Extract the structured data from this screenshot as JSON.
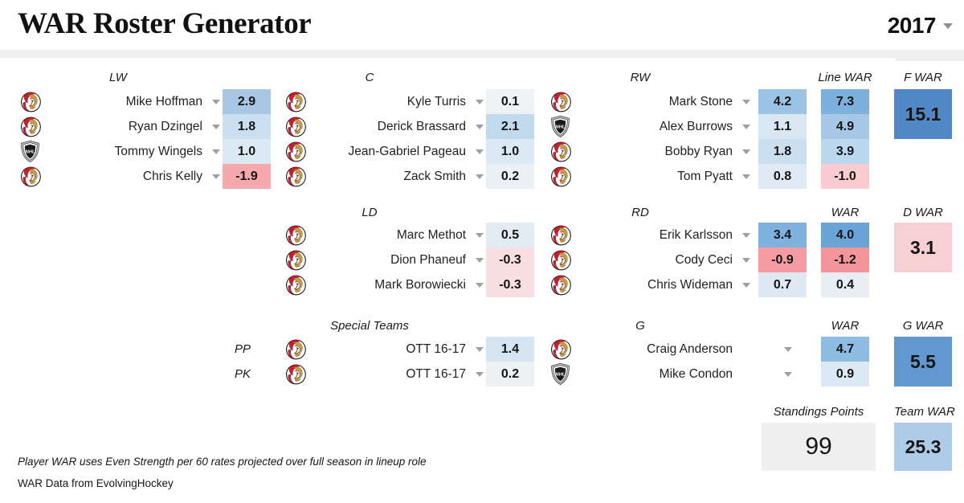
{
  "header": {
    "title": "WAR Roster Generator",
    "season": "2017",
    "season_caret_icon": "chevron-down-icon"
  },
  "columns": {
    "lw": "LW",
    "c": "C",
    "rw": "RW",
    "line_war": "Line WAR",
    "f_war": "F WAR",
    "ld": "LD",
    "rd": "RD",
    "d_war_head": "WAR",
    "d_war": "D WAR",
    "special_teams": "Special Teams",
    "g": "G",
    "g_war_head": "WAR",
    "g_war": "G WAR",
    "standings_points": "Standings Points",
    "team_war": "Team WAR"
  },
  "forwards": {
    "lw": [
      {
        "logo": "senators-logo",
        "name": "Mike Hoffman",
        "war": "2.9",
        "color": "#a8c7e4"
      },
      {
        "logo": "senators-logo",
        "name": "Ryan Dzingel",
        "war": "1.8",
        "color": "#cadff0"
      },
      {
        "logo": "nhl-logo",
        "name": "Tommy Wingels",
        "war": "1.0",
        "color": "#dce9f4"
      },
      {
        "logo": "senators-logo",
        "name": "Chris Kelly",
        "war": "-1.9",
        "color": "#f6a9ad"
      }
    ],
    "c": [
      {
        "logo": "senators-logo",
        "name": "Kyle Turris",
        "war": "0.1",
        "color": "#eef2f5"
      },
      {
        "logo": "senators-logo",
        "name": "Derick Brassard",
        "war": "2.1",
        "color": "#c2daee"
      },
      {
        "logo": "senators-logo",
        "name": "Jean-Gabriel Pageau",
        "war": "1.0",
        "color": "#dce9f4"
      },
      {
        "logo": "senators-logo",
        "name": "Zack Smith",
        "war": "0.2",
        "color": "#eaf0f5"
      }
    ],
    "rw": [
      {
        "logo": "senators-logo",
        "name": "Mark Stone",
        "war": "4.2",
        "color": "#9cc3e3"
      },
      {
        "logo": "nhl-logo",
        "name": "Alex Burrows",
        "war": "1.1",
        "color": "#d9e7f3"
      },
      {
        "logo": "senators-logo",
        "name": "Bobby Ryan",
        "war": "1.8",
        "color": "#cadff0"
      },
      {
        "logo": "senators-logo",
        "name": "Tom Pyatt",
        "war": "0.8",
        "color": "#dfeaf5"
      }
    ],
    "line_war": [
      {
        "value": "7.3",
        "color": "#7db0dc"
      },
      {
        "value": "4.9",
        "color": "#a6c8e6"
      },
      {
        "value": "3.9",
        "color": "#bcd8ee"
      },
      {
        "value": "-1.0",
        "color": "#f9ccd0"
      }
    ],
    "f_war": {
      "value": "15.1",
      "color": "#5189c8"
    }
  },
  "defense": {
    "ld": [
      {
        "logo": "senators-logo",
        "name": "Marc Methot",
        "war": "0.5",
        "color": "#e3ebf2"
      },
      {
        "logo": "senators-logo",
        "name": "Dion Phaneuf",
        "war": "-0.3",
        "color": "#fadfe0"
      },
      {
        "logo": "senators-logo",
        "name": "Mark Borowiecki",
        "war": "-0.3",
        "color": "#fadfe0"
      }
    ],
    "rd": [
      {
        "logo": "senators-logo",
        "name": "Erik Karlsson",
        "war": "3.4",
        "color": "#7eb1dd"
      },
      {
        "logo": "senators-logo",
        "name": "Cody Ceci",
        "war": "-0.9",
        "color": "#f59ba1"
      },
      {
        "logo": "senators-logo",
        "name": "Chris Wideman",
        "war": "0.7",
        "color": "#dfe9f3"
      }
    ],
    "war": [
      {
        "value": "4.0",
        "color": "#6ba5d8"
      },
      {
        "value": "-1.2",
        "color": "#f4949b"
      },
      {
        "value": "0.4",
        "color": "#e7eef4"
      }
    ],
    "d_war": {
      "value": "3.1",
      "color": "#f8cfd2"
    }
  },
  "special_teams": [
    {
      "label": "PP",
      "logo": "senators-logo",
      "team": "OTT 16-17",
      "war": "1.4",
      "color": "#d6e5f2"
    },
    {
      "label": "PK",
      "logo": "senators-logo",
      "team": "OTT 16-17",
      "war": "0.2",
      "color": "#edf1f4"
    }
  ],
  "goalies": {
    "rows": [
      {
        "logo": "senators-logo",
        "name": "Craig Anderson",
        "war": "4.7",
        "color": "#8fbce2"
      },
      {
        "logo": "nhl-logo",
        "name": "Mike Condon",
        "war": "0.9",
        "color": "#dde9f4"
      }
    ],
    "g_war": {
      "value": "5.5",
      "color": "#6198cf"
    }
  },
  "summary": {
    "standings_points": {
      "value": "99",
      "color": "#efefef"
    },
    "team_war": {
      "value": "25.3",
      "color": "#aecce8"
    }
  },
  "footer": {
    "line1": "Player WAR uses Even Strength per 60 rates projected over full season in lineup role",
    "line2": "WAR Data from EvolvingHockey"
  }
}
